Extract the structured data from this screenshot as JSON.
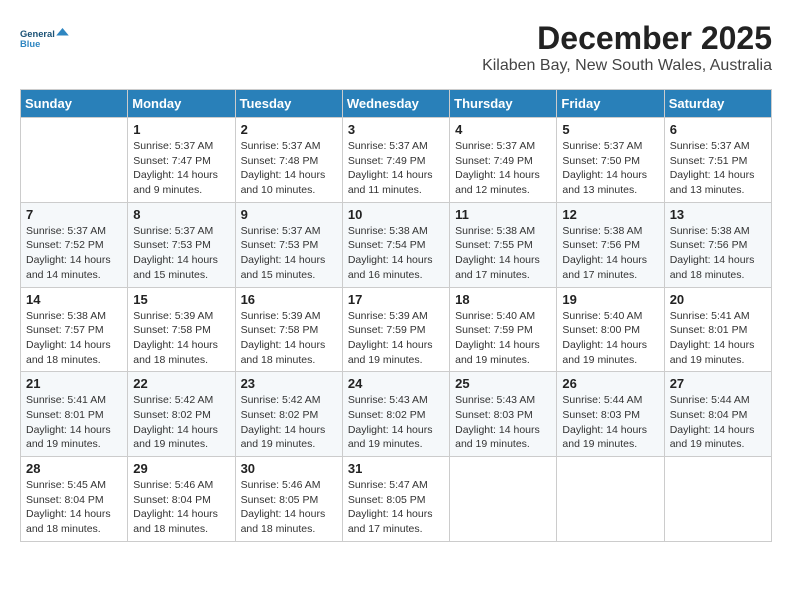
{
  "logo": {
    "line1": "General",
    "line2": "Blue"
  },
  "title": "December 2025",
  "location": "Kilaben Bay, New South Wales, Australia",
  "days_of_week": [
    "Sunday",
    "Monday",
    "Tuesday",
    "Wednesday",
    "Thursday",
    "Friday",
    "Saturday"
  ],
  "weeks": [
    [
      {
        "day": "",
        "info": ""
      },
      {
        "day": "1",
        "info": "Sunrise: 5:37 AM\nSunset: 7:47 PM\nDaylight: 14 hours\nand 9 minutes."
      },
      {
        "day": "2",
        "info": "Sunrise: 5:37 AM\nSunset: 7:48 PM\nDaylight: 14 hours\nand 10 minutes."
      },
      {
        "day": "3",
        "info": "Sunrise: 5:37 AM\nSunset: 7:49 PM\nDaylight: 14 hours\nand 11 minutes."
      },
      {
        "day": "4",
        "info": "Sunrise: 5:37 AM\nSunset: 7:49 PM\nDaylight: 14 hours\nand 12 minutes."
      },
      {
        "day": "5",
        "info": "Sunrise: 5:37 AM\nSunset: 7:50 PM\nDaylight: 14 hours\nand 13 minutes."
      },
      {
        "day": "6",
        "info": "Sunrise: 5:37 AM\nSunset: 7:51 PM\nDaylight: 14 hours\nand 13 minutes."
      }
    ],
    [
      {
        "day": "7",
        "info": "Sunrise: 5:37 AM\nSunset: 7:52 PM\nDaylight: 14 hours\nand 14 minutes."
      },
      {
        "day": "8",
        "info": "Sunrise: 5:37 AM\nSunset: 7:53 PM\nDaylight: 14 hours\nand 15 minutes."
      },
      {
        "day": "9",
        "info": "Sunrise: 5:37 AM\nSunset: 7:53 PM\nDaylight: 14 hours\nand 15 minutes."
      },
      {
        "day": "10",
        "info": "Sunrise: 5:38 AM\nSunset: 7:54 PM\nDaylight: 14 hours\nand 16 minutes."
      },
      {
        "day": "11",
        "info": "Sunrise: 5:38 AM\nSunset: 7:55 PM\nDaylight: 14 hours\nand 17 minutes."
      },
      {
        "day": "12",
        "info": "Sunrise: 5:38 AM\nSunset: 7:56 PM\nDaylight: 14 hours\nand 17 minutes."
      },
      {
        "day": "13",
        "info": "Sunrise: 5:38 AM\nSunset: 7:56 PM\nDaylight: 14 hours\nand 18 minutes."
      }
    ],
    [
      {
        "day": "14",
        "info": "Sunrise: 5:38 AM\nSunset: 7:57 PM\nDaylight: 14 hours\nand 18 minutes."
      },
      {
        "day": "15",
        "info": "Sunrise: 5:39 AM\nSunset: 7:58 PM\nDaylight: 14 hours\nand 18 minutes."
      },
      {
        "day": "16",
        "info": "Sunrise: 5:39 AM\nSunset: 7:58 PM\nDaylight: 14 hours\nand 18 minutes."
      },
      {
        "day": "17",
        "info": "Sunrise: 5:39 AM\nSunset: 7:59 PM\nDaylight: 14 hours\nand 19 minutes."
      },
      {
        "day": "18",
        "info": "Sunrise: 5:40 AM\nSunset: 7:59 PM\nDaylight: 14 hours\nand 19 minutes."
      },
      {
        "day": "19",
        "info": "Sunrise: 5:40 AM\nSunset: 8:00 PM\nDaylight: 14 hours\nand 19 minutes."
      },
      {
        "day": "20",
        "info": "Sunrise: 5:41 AM\nSunset: 8:01 PM\nDaylight: 14 hours\nand 19 minutes."
      }
    ],
    [
      {
        "day": "21",
        "info": "Sunrise: 5:41 AM\nSunset: 8:01 PM\nDaylight: 14 hours\nand 19 minutes."
      },
      {
        "day": "22",
        "info": "Sunrise: 5:42 AM\nSunset: 8:02 PM\nDaylight: 14 hours\nand 19 minutes."
      },
      {
        "day": "23",
        "info": "Sunrise: 5:42 AM\nSunset: 8:02 PM\nDaylight: 14 hours\nand 19 minutes."
      },
      {
        "day": "24",
        "info": "Sunrise: 5:43 AM\nSunset: 8:02 PM\nDaylight: 14 hours\nand 19 minutes."
      },
      {
        "day": "25",
        "info": "Sunrise: 5:43 AM\nSunset: 8:03 PM\nDaylight: 14 hours\nand 19 minutes."
      },
      {
        "day": "26",
        "info": "Sunrise: 5:44 AM\nSunset: 8:03 PM\nDaylight: 14 hours\nand 19 minutes."
      },
      {
        "day": "27",
        "info": "Sunrise: 5:44 AM\nSunset: 8:04 PM\nDaylight: 14 hours\nand 19 minutes."
      }
    ],
    [
      {
        "day": "28",
        "info": "Sunrise: 5:45 AM\nSunset: 8:04 PM\nDaylight: 14 hours\nand 18 minutes."
      },
      {
        "day": "29",
        "info": "Sunrise: 5:46 AM\nSunset: 8:04 PM\nDaylight: 14 hours\nand 18 minutes."
      },
      {
        "day": "30",
        "info": "Sunrise: 5:46 AM\nSunset: 8:05 PM\nDaylight: 14 hours\nand 18 minutes."
      },
      {
        "day": "31",
        "info": "Sunrise: 5:47 AM\nSunset: 8:05 PM\nDaylight: 14 hours\nand 17 minutes."
      },
      {
        "day": "",
        "info": ""
      },
      {
        "day": "",
        "info": ""
      },
      {
        "day": "",
        "info": ""
      }
    ]
  ]
}
